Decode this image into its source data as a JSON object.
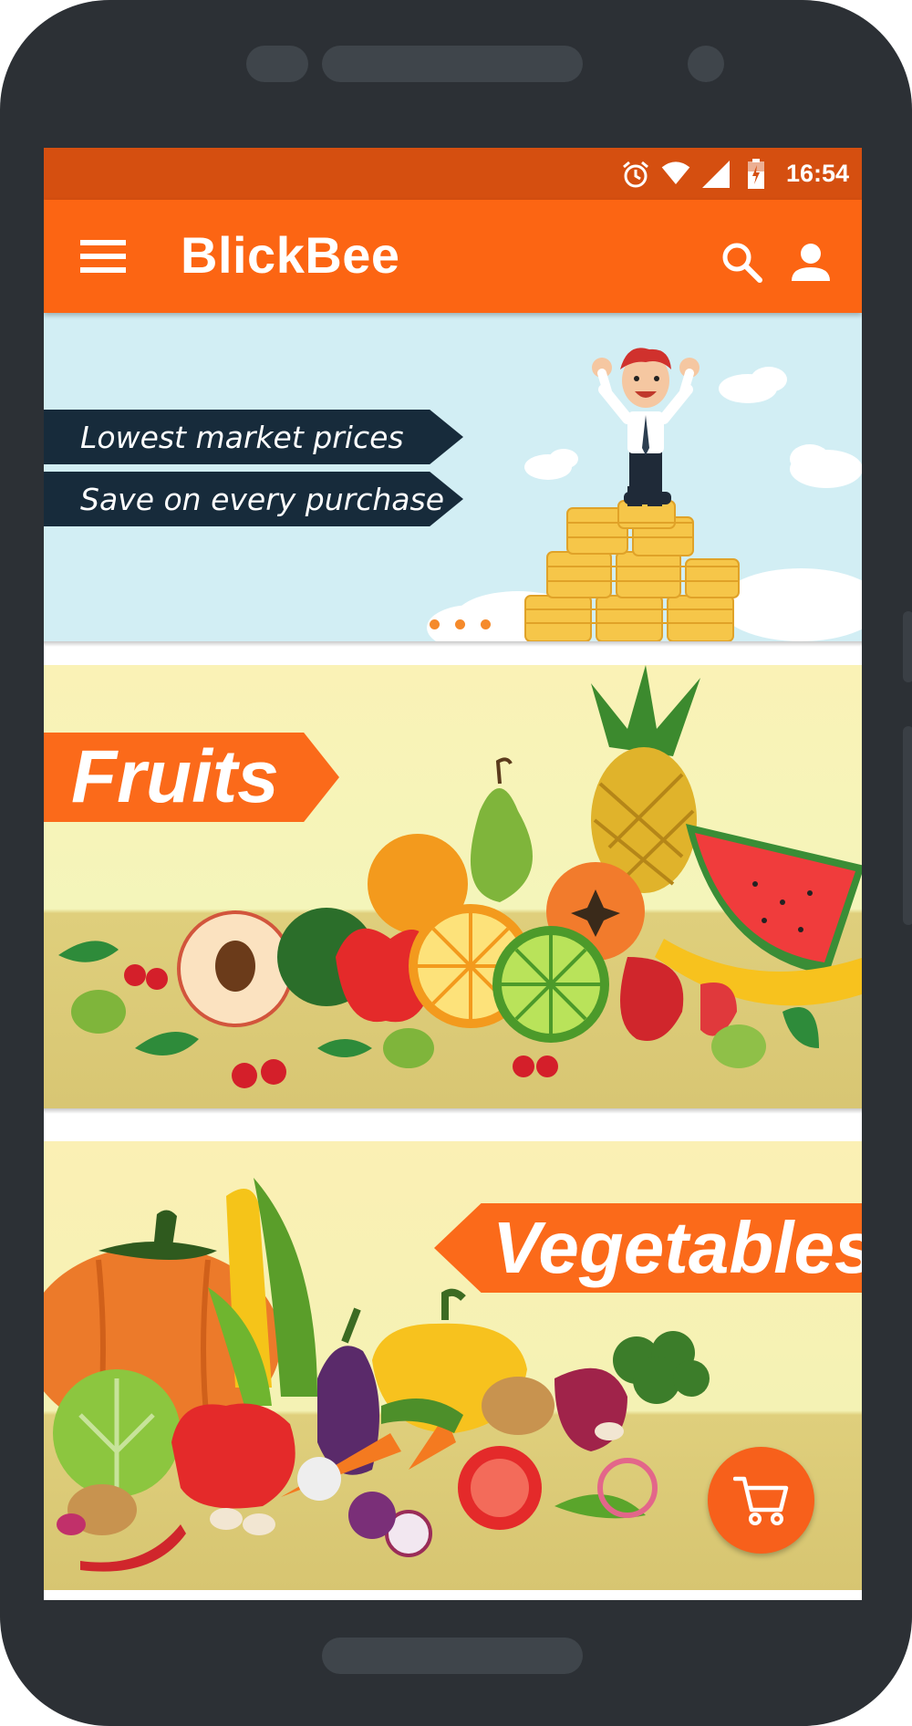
{
  "status_bar": {
    "time": "16:54",
    "icons": [
      "alarm-icon",
      "wifi-icon",
      "signal-icon",
      "battery-icon"
    ]
  },
  "app_bar": {
    "title": "BlickBee",
    "icons": [
      "menu-icon",
      "search-icon",
      "account-icon"
    ]
  },
  "promo_banner": {
    "line1": "Lowest market prices",
    "line2": "Save on every purchase",
    "carousel_pages": 3
  },
  "categories": [
    {
      "label": "Fruits"
    },
    {
      "label": "Vegetables"
    }
  ],
  "fab": {
    "icon": "cart-icon"
  },
  "colors": {
    "status_bar": "#d54f10",
    "app_bar": "#fc6513",
    "accent": "#fb6a1a",
    "ribbon": "#172b3b",
    "phone_body": "#2c3035"
  }
}
